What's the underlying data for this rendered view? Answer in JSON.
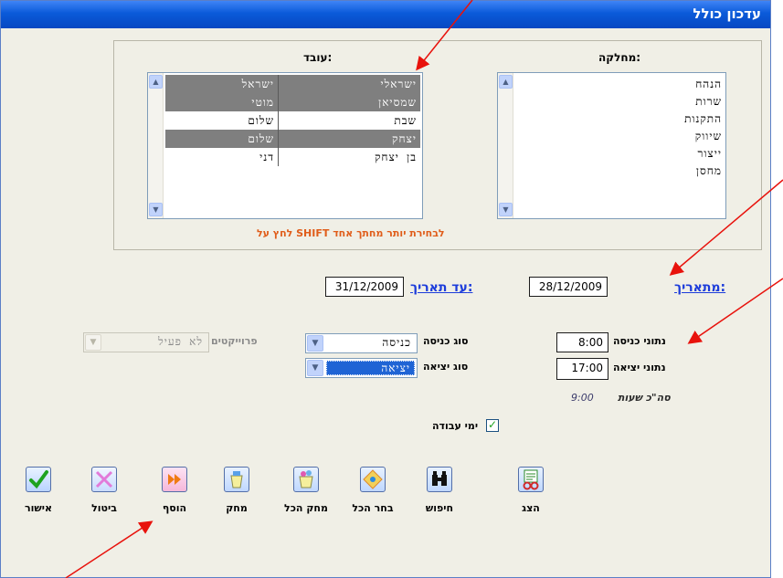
{
  "window": {
    "title": "עדכון כולל"
  },
  "lists": {
    "department_label": "מחלקה:",
    "employee_label": "עובד:",
    "departments": [
      "הנהח",
      "שרות",
      "התקנות",
      "שיווק",
      "ייצור",
      "מחסן"
    ],
    "employees": [
      {
        "first": "ישראל",
        "last": "ישראלי",
        "selected": true
      },
      {
        "first": "מוטי",
        "last": "שמסיאן",
        "selected": true
      },
      {
        "first": "שלום",
        "last": "שבת",
        "selected": false
      },
      {
        "first": "שלום",
        "last": "יצחק",
        "selected": true
      },
      {
        "first": "דני",
        "last": "בן יצחק",
        "selected": false
      }
    ],
    "hint": "לחץ על SHIFT לבחירת יותר מחתך אחד"
  },
  "dates": {
    "from_label": "מתאריך:",
    "from_value": "28/12/2009",
    "to_label": "עד תאריך:",
    "to_value": "31/12/2009"
  },
  "times": {
    "entry_label": "נתוני כניסה",
    "entry_value": "8:00",
    "exit_label": "נתוני יציאה",
    "exit_value": "17:00",
    "total_label": "סה\"כ שעות",
    "total_value": "9:00"
  },
  "types": {
    "entry_type_label": "סוג כניסה",
    "entry_type_value": "כניסה",
    "exit_type_label": "סוג יציאה",
    "exit_type_value": "יציאה"
  },
  "projects": {
    "label": "פרוייקטים",
    "value": "לא פעיל"
  },
  "workdays": {
    "label": "ימי עבודה",
    "checked": true
  },
  "toolbar": {
    "approve": "אישור",
    "cancel": "ביטול",
    "add": "הוסף",
    "delete": "מחק",
    "delete_all": "מחק הכל",
    "select_all": "בחר הכל",
    "search": "חיפוש",
    "show": "הצג"
  },
  "colors": {
    "titlebar": "#0a5ad9",
    "link": "#1c3cdb",
    "hint": "#e05d1a",
    "annotation_arrow": "#e8120c"
  }
}
